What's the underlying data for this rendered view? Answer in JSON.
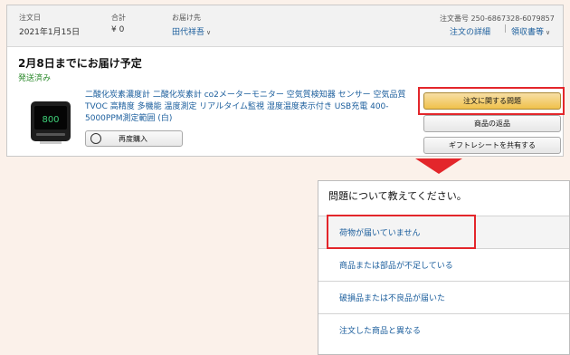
{
  "order": {
    "date_label": "注文日",
    "date_value": "2021年1月15日",
    "total_label": "合計",
    "total_value": "¥ 0",
    "ship_to_label": "お届け先",
    "ship_to_value": "田代祥吾",
    "order_number_label": "注文番号",
    "order_number_value": "250-6867328-6079857",
    "details_link": "注文の詳細",
    "receipt_link": "領収書等",
    "delivery_status": "2月8日までにお届け予定",
    "shipped_status": "発送済み",
    "product_title": "二酸化炭素濃度計 二酸化炭素計 co2メーターモニター 空気質検知器 センサー 空気品質 TVOC 高精度 多機能 温度測定 リアルタイム監視 湿度温度表示付き USB充電 400-5000PPM測定範囲 (白)",
    "buy_again": "再度購入",
    "thumb_readout": "800"
  },
  "actions": {
    "problem": "注文に関する問題",
    "return": "商品の返品",
    "gift_receipt": "ギフトレシートを共有する"
  },
  "panel": {
    "title": "問題について教えてください。",
    "options": [
      "荷物が届いていません",
      "商品または部品が不足している",
      "破損品または不良品が届いた",
      "注文した商品と異なる"
    ]
  },
  "colors": {
    "highlight": "#e3262b",
    "link": "#1a5d9c",
    "primary_button": "#f0c14b",
    "shipped": "#2d8a2d"
  }
}
